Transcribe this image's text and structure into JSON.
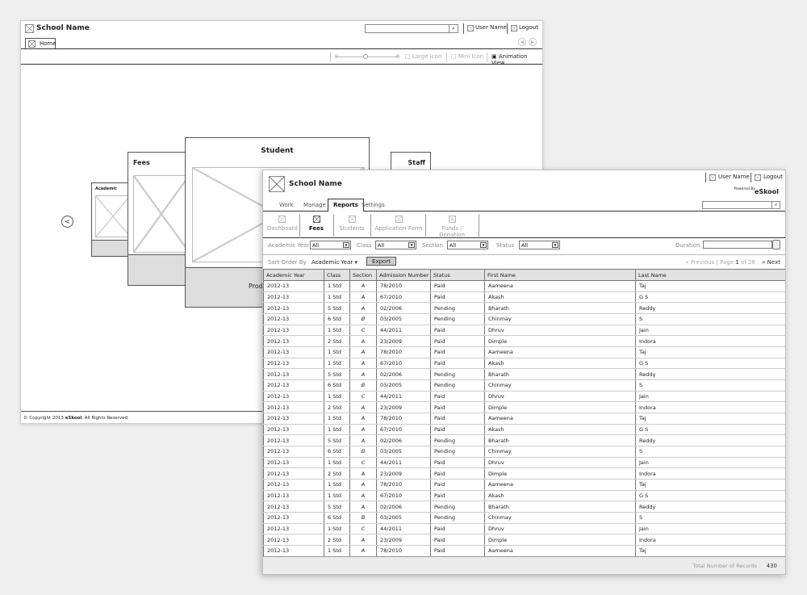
{
  "back": {
    "school_name": "School Name",
    "user_name": "User Name",
    "logout": "Logout",
    "home_tab": "Home",
    "toolbar": {
      "large_icon": "Large Icon",
      "mini_icon": "Mini Icon",
      "animation_view": "Animation View"
    },
    "cards": {
      "academic": "Academic",
      "fees": "Fees",
      "student": "Student",
      "staff": "Staff",
      "student_footer": "Prod"
    },
    "prev_arrow": "<",
    "footer": {
      "copyright": "© Copyright 2013 ",
      "brand": "eSkool",
      "rights": ". All Rights Reserved."
    }
  },
  "front": {
    "school_name": "School Name",
    "user_name": "User Name",
    "logout": "Logout",
    "powered_by": "Powered By",
    "brand": "eSkool",
    "tabs": [
      "Work",
      "Manage",
      "Reports",
      "Settings"
    ],
    "active_tab": "Reports",
    "subtoolbar": [
      "Dashboard",
      "Fees",
      "Students",
      "Application Form",
      "Funds / Donation"
    ],
    "active_sub": "Fees",
    "filters": {
      "academic_year_label": "Academic Year",
      "academic_year_value": "All",
      "class_label": "Class",
      "class_value": "All",
      "section_label": "Section",
      "section_value": "All",
      "status_label": "Status",
      "status_value": "All",
      "duration_label": "Duration"
    },
    "sort": {
      "label": "Sort Order By",
      "value": "Academic Year ▾"
    },
    "export": "Export",
    "pager": {
      "previous": "«  Previous",
      "page_prefix": "Page",
      "current": "1",
      "of": "of",
      "total_pages": "26",
      "next": "»  Next"
    },
    "columns": [
      "Academic Year",
      "Class",
      "Section",
      "Admission Number",
      "Status",
      "First Name",
      "Last Name"
    ],
    "rows": [
      [
        "2012-13",
        "1 Std",
        "A",
        "78/2010",
        "Paid",
        "Aameena",
        "Taj"
      ],
      [
        "2012-13",
        "1 Std",
        "A",
        "67/2010",
        "Paid",
        "Akash",
        "G S"
      ],
      [
        "2012-13",
        "5 Std",
        "A",
        "02/2006",
        "Pending",
        "Bharath",
        "Reddy"
      ],
      [
        "2012-13",
        "6 Std",
        "B",
        "03/2005",
        "Pending",
        "Chinmay",
        "S"
      ],
      [
        "2012-13",
        "1 Std",
        "C",
        "44/2011",
        "Paid",
        "Dhruv",
        "Jain"
      ],
      [
        "2012-13",
        "2 Std",
        "A",
        "23/2009",
        "Paid",
        "Dimple",
        "Indora"
      ],
      [
        "2012-13",
        "1 Std",
        "A",
        "78/2010",
        "Paid",
        "Aameena",
        "Taj"
      ],
      [
        "2012-13",
        "1 Std",
        "A",
        "67/2010",
        "Paid",
        "Akash",
        "G S"
      ],
      [
        "2012-13",
        "5 Std",
        "A",
        "02/2006",
        "Pending",
        "Bharath",
        "Reddy"
      ],
      [
        "2012-13",
        "6 Std",
        "B",
        "03/2005",
        "Pending",
        "Chinmay",
        "S"
      ],
      [
        "2012-13",
        "1 Std",
        "C",
        "44/2011",
        "Paid",
        "Dhruv",
        "Jain"
      ],
      [
        "2012-13",
        "2 Std",
        "A",
        "23/2009",
        "Paid",
        "Dimple",
        "Indora"
      ],
      [
        "2012-13",
        "1 Std",
        "A",
        "78/2010",
        "Paid",
        "Aameena",
        "Taj"
      ],
      [
        "2012-13",
        "1 Std",
        "A",
        "67/2010",
        "Paid",
        "Akash",
        "G S"
      ],
      [
        "2012-13",
        "5 Std",
        "A",
        "02/2006",
        "Pending",
        "Bharath",
        "Reddy"
      ],
      [
        "2012-13",
        "6 Std",
        "B",
        "03/2005",
        "Pending",
        "Chinmay",
        "S"
      ],
      [
        "2012-13",
        "1 Std",
        "C",
        "44/2011",
        "Paid",
        "Dhruv",
        "Jain"
      ],
      [
        "2012-13",
        "2 Std",
        "A",
        "23/2009",
        "Paid",
        "Dimple",
        "Indora"
      ],
      [
        "2012-13",
        "1 Std",
        "A",
        "78/2010",
        "Paid",
        "Aameena",
        "Taj"
      ],
      [
        "2012-13",
        "1 Std",
        "A",
        "67/2010",
        "Paid",
        "Akash",
        "G S"
      ],
      [
        "2012-13",
        "5 Std",
        "A",
        "02/2006",
        "Pending",
        "Bharath",
        "Reddy"
      ],
      [
        "2012-13",
        "6 Std",
        "B",
        "03/2005",
        "Pending",
        "Chinmay",
        "S"
      ],
      [
        "2012-13",
        "1 Std",
        "C",
        "44/2011",
        "Paid",
        "Dhruv",
        "Jain"
      ],
      [
        "2012-13",
        "2 Std",
        "A",
        "23/2009",
        "Paid",
        "Dimple",
        "Indora"
      ],
      [
        "2012-13",
        "1 Std",
        "A",
        "78/2010",
        "Paid",
        "Aameena",
        "Taj"
      ]
    ],
    "total_label": "Total Number of Records",
    "total_value": "430"
  }
}
